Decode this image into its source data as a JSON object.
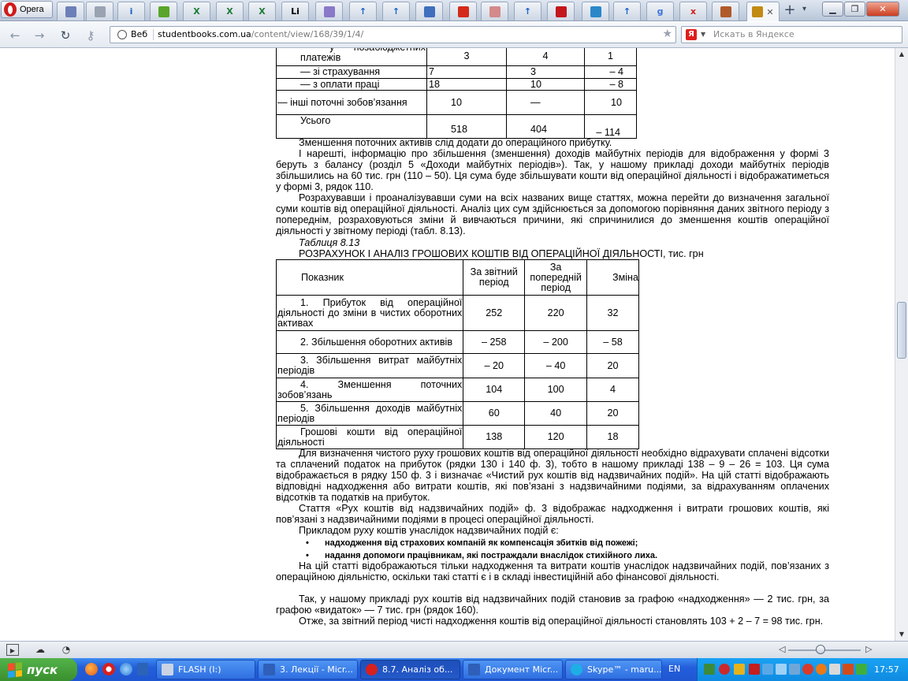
{
  "browser": {
    "menu_label": "Opera",
    "tabs": [
      {
        "icon": "window-icon",
        "glyph": "",
        "color": "#6d7fb8"
      },
      {
        "icon": "page-icon",
        "glyph": "",
        "color": "#9aa3b2"
      },
      {
        "icon": "info-icon",
        "glyph": "i",
        "color": "#1b5fc9"
      },
      {
        "icon": "apple-icon",
        "glyph": "",
        "color": "#5aa52a"
      },
      {
        "icon": "excel-icon",
        "glyph": "X",
        "color": "#1e7b34"
      },
      {
        "icon": "excel-icon",
        "glyph": "X",
        "color": "#1e7b34"
      },
      {
        "icon": "excel-icon",
        "glyph": "X",
        "color": "#1e7b34"
      },
      {
        "icon": "li-icon",
        "glyph": "Li",
        "color": "#000000"
      },
      {
        "icon": "window-icon",
        "glyph": "",
        "color": "#8a78c8"
      },
      {
        "icon": "upload-arrow-icon",
        "glyph": "↑",
        "color": "#1760c8"
      },
      {
        "icon": "upload-arrow-icon",
        "glyph": "↑",
        "color": "#1760c8"
      },
      {
        "icon": "document-icon",
        "glyph": "",
        "color": "#3f6fbe"
      },
      {
        "icon": "red-logo-icon",
        "glyph": "",
        "color": "#d42a1a"
      },
      {
        "icon": "chart-icon",
        "glyph": "",
        "color": "#d48a8a"
      },
      {
        "icon": "upload-arrow-icon",
        "glyph": "↑",
        "color": "#1760c8"
      },
      {
        "icon": "red-x-logo-icon",
        "glyph": "",
        "color": "#c4161c"
      },
      {
        "icon": "es-icon",
        "glyph": "",
        "color": "#2a88c8"
      },
      {
        "icon": "upload-arrow-icon",
        "glyph": "↑",
        "color": "#1760c8"
      },
      {
        "icon": "google-icon",
        "glyph": "g",
        "color": "#3b73d9"
      },
      {
        "icon": "red-x-icon",
        "glyph": "x",
        "color": "#d81b1b"
      },
      {
        "icon": "books-icon",
        "glyph": "",
        "color": "#b05a2a"
      },
      {
        "icon": "graduation-cap-icon",
        "glyph": "",
        "color": "#c28a12"
      }
    ],
    "active_tab_close": "✕",
    "new_tab": "+",
    "tab_list": "▾",
    "window_controls": {
      "minimize": "▁",
      "restore": "❐",
      "close": "✕"
    },
    "address": {
      "scheme_label": "Веб",
      "host": "studentbooks.com.ua",
      "path": "/content/view/168/39/1/4/"
    },
    "search": {
      "placeholder": "Искать в Яндексе",
      "engine_glyph": "Я"
    },
    "zoom": {
      "level": 0.45
    }
  },
  "article": {
    "table1": {
      "rows": [
        {
          "label": "— у позабюджетних платежів",
          "a": "3",
          "b": "4",
          "c": "1"
        },
        {
          "label": "— зі страхування",
          "a": "7",
          "b": "3",
          "c": "– 4"
        },
        {
          "label": "— з оплати праці",
          "a": "18",
          "b": "10",
          "c": "– 8"
        },
        {
          "label": "— інші поточні зобов’язання",
          "a": "10",
          "b": "—",
          "c": "10"
        },
        {
          "label": "Усього",
          "a": "518",
          "b": "404",
          "c": "– 114"
        }
      ]
    },
    "p1": "Зменшення поточних активів слід додати до операційного прибутку.",
    "p2": "І нарешті, інформацію про збільшення (зменшення) доходів майбутніх періодів для відображення у формі 3 беруть з балансу (розділ 5 «Доходи майбутніх періодів»). Так, у нашому прикладі доходи майбутніх періодів збільшились на 60 тис. грн (110 – 50). Ця сума буде збільшувати кошти від операційної діяльності і відображатиметься у формі 3, рядок 110.",
    "p3": "Розрахувавши і проаналізувавши суми на всіх названих вище статтях, можна перейти до визначення загальної суми коштів від операційної діяльності. Аналіз цих сум здійснюється за допомогою порівняння даних звітного періоду з попереднім, розраховуються зміни й вивчаються причини, які спричинилися до зменшення коштів операційної діяльності у звітному періоді (табл. 8.13).",
    "table_caption": "Таблиця 8.13",
    "table_title": "РОЗРАХУНОК І АНАЛІЗ ГРОШОВИХ КОШТІВ ВІД ОПЕРАЦІЙНОЇ ДІЯЛЬНОСТІ, тис. грн",
    "table2": {
      "headers": [
        "Показник",
        "За звітний період",
        "За попередній період",
        "Зміна"
      ],
      "rows": [
        {
          "label": "1. Прибуток від операційної діяльності до зміни в чистих оборотних активах",
          "a": "252",
          "b": "220",
          "c": "32"
        },
        {
          "label": "2. Збільшення оборотних активів",
          "a": "– 258",
          "b": "– 200",
          "c": "– 58"
        },
        {
          "label": "3. Збільшення витрат майбутніх періодів",
          "a": "– 20",
          "b": "– 40",
          "c": "20"
        },
        {
          "label": "4. Зменшення поточних зобов’язань",
          "a": "104",
          "b": "100",
          "c": "4"
        },
        {
          "label": "5. Збільшення доходів майбутніх періодів",
          "a": "60",
          "b": "40",
          "c": "20"
        },
        {
          "label": "Грошові кошти від операційної діяльності",
          "a": "138",
          "b": "120",
          "c": "18"
        }
      ]
    },
    "p4": "Для визначення чистого руху грошових коштів від операційної діяльності необхідно відрахувати сплачені відсотки та сплачений податок на прибуток (рядки 130 і 140 ф. 3), тобто в нашому прикладі 138 – 9 – 26 = 103. Ця сума відображається в рядку 150 ф. 3 і визначає «Чистий рух коштів від надзвичайних подій». На цій статті відображають відповідні надходження або витрати коштів, які пов’язані з надзвичайними подіями, за відрахуванням оплачених відсотків та податків на прибуток.",
    "p5": "Стаття «Рух коштів від надзвичайних подій» ф. 3 відображає надходження і витрати грошових коштів, які пов’язані з надзвичайними подіями в процесі операційної діяльності.",
    "p6": "Прикладом руху коштів унаслідок надзвичайних подій є:",
    "bullets": [
      "надходження від страхових компаній як компенсація збитків від пожежі;",
      "надання допомоги працівникам, які постраждали внаслідок стихійного лиха."
    ],
    "bullet_glyph": "•",
    "p7": "На цій статті відображаються тільки надходження та витрати коштів унаслідок надзвичайних подій, пов’язаних з операційною діяльністю, оскільки такі статті є і в складі інвестиційній або фінансової діяльності.",
    "p8": "Так, у нашому прикладі рух коштів від надзвичайних подій становив за графою «надходження» — 2 тис. грн, за графою «видаток» — 7 тис. грн (рядок 160).",
    "p9": "Отже, за звітний період чисті надходження коштів від операційної діяльності становлять 103 + 2 – 7 = 98 тис. грн."
  },
  "taskbar": {
    "start_label": "пуск",
    "buttons": [
      {
        "label": "FLASH (I:)",
        "icon": "drive-icon",
        "color": "#c9d3e3"
      },
      {
        "label": "3. Лекції - Micr...",
        "icon": "word-icon",
        "color": "#2f5fb8"
      },
      {
        "label": "8.7. Аналіз об...",
        "icon": "opera-icon",
        "color": "#d8201c"
      },
      {
        "label": "Документ Micr...",
        "icon": "word-icon",
        "color": "#2f5fb8"
      },
      {
        "label": "Skype™ - maru...",
        "icon": "skype-icon",
        "color": "#1eaee6"
      }
    ],
    "language": "EN",
    "clock": "17:57"
  },
  "colors": {
    "tab_bar_top": "#dfe6f0",
    "taskbar_blue": "#245edb",
    "start_green": "#3a8f2e",
    "tray_blue": "#0f8be2"
  }
}
